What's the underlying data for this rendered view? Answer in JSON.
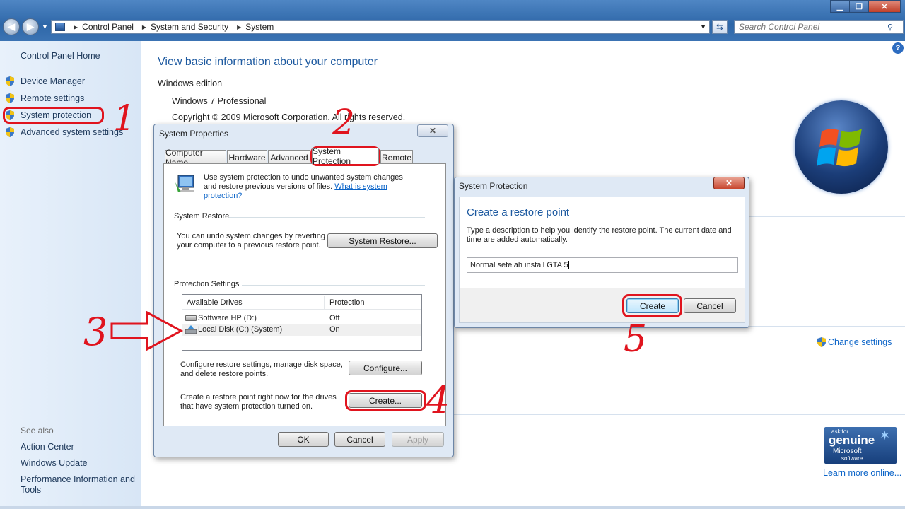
{
  "window": {
    "minimize": "▁",
    "maximize": "❐",
    "close": "✕"
  },
  "address": {
    "crumbs": [
      "Control Panel",
      "System and Security",
      "System"
    ],
    "search_placeholder": "Search Control Panel"
  },
  "sidebar": {
    "home": "Control Panel Home",
    "items": [
      {
        "label": "Device Manager"
      },
      {
        "label": "Remote settings"
      },
      {
        "label": "System protection"
      },
      {
        "label": "Advanced system settings"
      }
    ],
    "see_also_title": "See also",
    "see_also": [
      "Action Center",
      "Windows Update",
      "Performance Information and Tools"
    ]
  },
  "main": {
    "heading": "View basic information about your computer",
    "section": "Windows edition",
    "edition": "Windows 7 Professional",
    "copyright": "Copyright © 2009 Microsoft Corporation.  All rights reserved.",
    "change_settings": "Change settings",
    "genuine_lines": [
      "ask for",
      "genuine",
      "Microsoft",
      "software"
    ],
    "learn_more": "Learn more online..."
  },
  "sysprops": {
    "title": "System Properties",
    "tabs": [
      "Computer Name",
      "Hardware",
      "Advanced",
      "System Protection",
      "Remote"
    ],
    "intro": "Use system protection to undo unwanted system changes and restore previous versions of files.",
    "intro_link": "What is system protection?",
    "restore_group": "System Restore",
    "restore_text": "You can undo system changes by reverting your computer to a previous restore point.",
    "restore_button": "System Restore...",
    "protection_group": "Protection Settings",
    "columns": [
      "Available Drives",
      "Protection"
    ],
    "drives": [
      {
        "name": "Software HP (D:)",
        "protection": "Off"
      },
      {
        "name": "Local Disk (C:) (System)",
        "protection": "On"
      }
    ],
    "configure_text": "Configure restore settings, manage disk space, and delete restore points.",
    "configure_button": "Configure...",
    "create_text": "Create a restore point right now for the drives that have system protection turned on.",
    "create_button": "Create...",
    "ok": "OK",
    "cancel": "Cancel",
    "apply": "Apply"
  },
  "restore_dialog": {
    "title": "System Protection",
    "heading": "Create a restore point",
    "description": "Type a description to help you identify the restore point. The current date and time are added automatically.",
    "input_value": "Normal setelah install GTA 5",
    "create": "Create",
    "cancel": "Cancel"
  },
  "annotations": [
    "1",
    "2",
    "3",
    "4",
    "5"
  ],
  "colors": {
    "annotation": "#e0141e",
    "heading": "#1e5aa0",
    "link": "#0b64c8",
    "sidebar": "#e4eef9"
  }
}
